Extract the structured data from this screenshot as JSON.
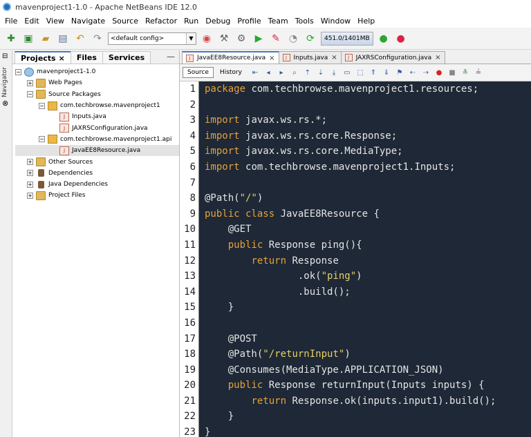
{
  "window": {
    "title": "mavenproject1-1.0 - Apache NetBeans IDE 12.0"
  },
  "menu": [
    "File",
    "Edit",
    "View",
    "Navigate",
    "Source",
    "Refactor",
    "Run",
    "Debug",
    "Profile",
    "Team",
    "Tools",
    "Window",
    "Help"
  ],
  "toolbar": {
    "config_value": "<default config>",
    "memory": "451.0/1401MB"
  },
  "side_strip": {
    "navigator_label": "Navigator"
  },
  "panel_tabs": [
    {
      "label": "Projects",
      "close": "×"
    },
    {
      "label": "Files"
    },
    {
      "label": "Services"
    }
  ],
  "panel_minimize": "—",
  "tree": [
    {
      "label": "mavenproject1-1.0",
      "level": 0,
      "expander": "−",
      "icon": "maven-project-icon"
    },
    {
      "label": "Web Pages",
      "level": 1,
      "expander": "+",
      "icon": "folder-icon"
    },
    {
      "label": "Source Packages",
      "level": 1,
      "expander": "−",
      "icon": "folder-icon"
    },
    {
      "label": "com.techbrowse.mavenproject1",
      "level": 2,
      "expander": "−",
      "icon": "package-icon"
    },
    {
      "label": "Inputs.java",
      "level": 3,
      "expander": "",
      "icon": "java-file-icon"
    },
    {
      "label": "JAXRSConfiguration.java",
      "level": 3,
      "expander": "",
      "icon": "java-file-icon"
    },
    {
      "label": "com.techbrowse.mavenproject1.api",
      "level": 2,
      "expander": "−",
      "icon": "package-icon"
    },
    {
      "label": "JavaEE8Resource.java",
      "level": 3,
      "expander": "",
      "icon": "java-file-icon",
      "selected": true
    },
    {
      "label": "Other Sources",
      "level": 1,
      "expander": "+",
      "icon": "folder-icon"
    },
    {
      "label": "Dependencies",
      "level": 1,
      "expander": "+",
      "icon": "jar-icon"
    },
    {
      "label": "Java Dependencies",
      "level": 1,
      "expander": "+",
      "icon": "jar-icon"
    },
    {
      "label": "Project Files",
      "level": 1,
      "expander": "+",
      "icon": "folder-icon"
    }
  ],
  "editor_tabs": [
    {
      "label": "JavaEE8Resource.java",
      "active": true,
      "close": "×"
    },
    {
      "label": "Inputs.java",
      "active": false,
      "close": "×"
    },
    {
      "label": "JAXRSConfiguration.java",
      "active": false,
      "close": "×"
    }
  ],
  "editor_views": {
    "source": "Source",
    "history": "History"
  },
  "code_lines": [
    [
      [
        "kw",
        "package "
      ],
      [
        "t",
        "com.techbrowse.mavenproject1.resources;"
      ]
    ],
    [],
    [
      [
        "kw",
        "import "
      ],
      [
        "t",
        "javax.ws.rs.*;"
      ]
    ],
    [
      [
        "kw",
        "import "
      ],
      [
        "t",
        "javax.ws.rs.core.Response;"
      ]
    ],
    [
      [
        "kw",
        "import "
      ],
      [
        "t",
        "javax.ws.rs.core.MediaType;"
      ]
    ],
    [
      [
        "kw",
        "import "
      ],
      [
        "t",
        "com.techbrowse.mavenproject1.Inputs;"
      ]
    ],
    [],
    [
      [
        "t",
        "@Path("
      ],
      [
        "str",
        "\"/\""
      ],
      [
        "t",
        ")"
      ]
    ],
    [
      [
        "kw",
        "public class "
      ],
      [
        "t",
        "JavaEE8Resource {"
      ]
    ],
    [
      [
        "t",
        "    @GET"
      ]
    ],
    [
      [
        "t",
        "    "
      ],
      [
        "kw",
        "public "
      ],
      [
        "t",
        "Response ping(){"
      ]
    ],
    [
      [
        "t",
        "        "
      ],
      [
        "kw",
        "return "
      ],
      [
        "t",
        "Response"
      ]
    ],
    [
      [
        "t",
        "                .ok("
      ],
      [
        "str",
        "\"ping\""
      ],
      [
        "t",
        ")"
      ]
    ],
    [
      [
        "t",
        "                .build();"
      ]
    ],
    [
      [
        "t",
        "    }"
      ]
    ],
    [],
    [
      [
        "t",
        "    @POST"
      ]
    ],
    [
      [
        "t",
        "    @Path("
      ],
      [
        "str",
        "\"/returnInput\""
      ],
      [
        "t",
        ")"
      ]
    ],
    [
      [
        "t",
        "    @Consumes(MediaType.APPLICATION_JSON)"
      ]
    ],
    [
      [
        "t",
        "    "
      ],
      [
        "kw",
        "public "
      ],
      [
        "t",
        "Response returnInput(Inputs inputs) {"
      ]
    ],
    [
      [
        "t",
        "        "
      ],
      [
        "kw",
        "return "
      ],
      [
        "t",
        "Response.ok(inputs.input1).build();"
      ]
    ],
    [
      [
        "t",
        "    }"
      ]
    ],
    [
      [
        "t",
        "}"
      ]
    ]
  ],
  "colors": {
    "editor_bg": "#1e2836",
    "keyword": "#e8a23a",
    "string": "#e8d066",
    "text": "#e6e6e6"
  }
}
